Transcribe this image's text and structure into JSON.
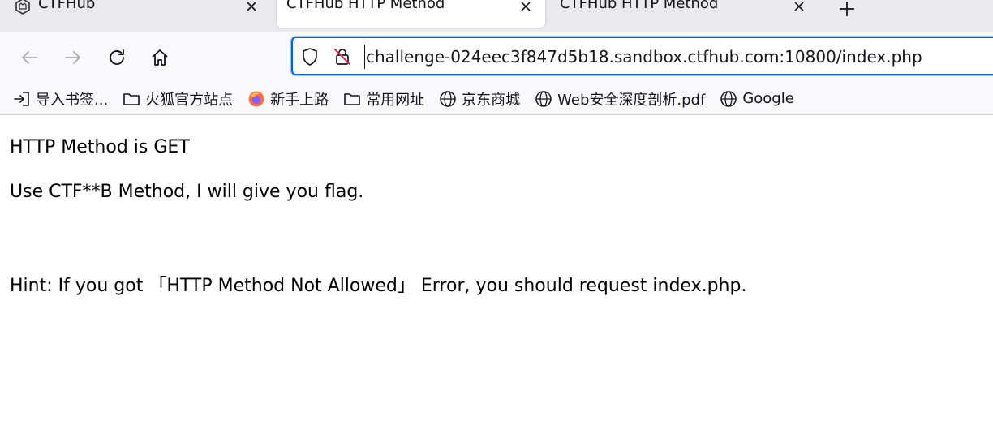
{
  "browser": {
    "tabs": [
      {
        "title": "CTFHub",
        "active": false
      },
      {
        "title": "CTFHub HTTP Method",
        "active": true
      },
      {
        "title": "CTFHub HTTP Method",
        "active": false
      }
    ],
    "url": "challenge-024eec3f847d5b18.sandbox.ctfhub.com:10800/index.php",
    "icons": {
      "back": "arrow-left-icon",
      "forward": "arrow-right-icon",
      "reload": "reload-icon",
      "home": "home-icon",
      "shield": "shield-icon",
      "insecure": "insecure-lock-icon",
      "new_tab": "plus-icon"
    },
    "colors": {
      "accent": "#0061e0",
      "insecure": "#e22850",
      "tabstrip": "#e9e9ee"
    }
  },
  "bookmarks": [
    {
      "label": "导入书签...",
      "icon": "import-icon"
    },
    {
      "label": "火狐官方站点",
      "icon": "folder-icon"
    },
    {
      "label": "新手上路",
      "icon": "firefox-icon"
    },
    {
      "label": "常用网址",
      "icon": "folder-icon"
    },
    {
      "label": "京东商城",
      "icon": "globe-icon"
    },
    {
      "label": "Web安全深度剖析.pdf",
      "icon": "globe-icon"
    },
    {
      "label": "Google",
      "icon": "globe-icon"
    }
  ],
  "page": {
    "line1": "HTTP Method is GET",
    "line2": "Use CTF**B Method, I will give you flag.",
    "hint": "Hint: If you got 「HTTP Method Not Allowed」 Error, you should request index.php."
  }
}
